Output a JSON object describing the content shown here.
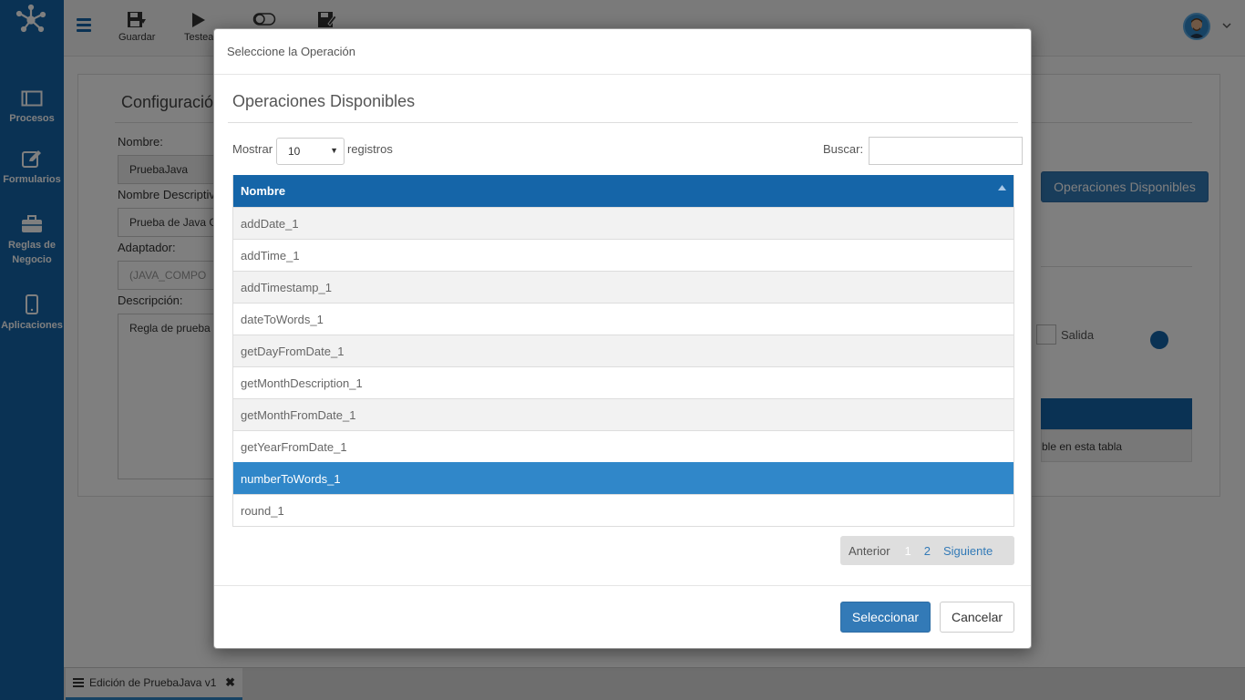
{
  "sidebar": {
    "items": [
      {
        "label": "Procesos",
        "icon": "window-icon"
      },
      {
        "label": "Formularios",
        "icon": "edit-icon"
      },
      {
        "label": "Reglas de Negocio",
        "icon": "briefcase-icon"
      },
      {
        "label": "Aplicaciones",
        "icon": "mobile-icon"
      }
    ]
  },
  "toolbar": {
    "save_label": "Guardar",
    "test_label": "Testea"
  },
  "background": {
    "panel_title": "Configuració",
    "nombre_label": "Nombre:",
    "nombre_value": "PruebaJava",
    "nombre_desc_label": "Nombre Descriptiv",
    "nombre_desc_value": "Prueba de Java C",
    "adaptador_label": "Adaptador:",
    "adaptador_value": "(JAVA_COMPO",
    "descripcion_label": "Descripción:",
    "descripcion_value": "Regla de prueba",
    "operaciones_button": "Operaciones Disponibles",
    "salida_label": "Salida",
    "table_empty": "ble en esta tabla"
  },
  "tabbar": {
    "tab_label": "Edición de PruebaJava v1"
  },
  "modal": {
    "title": "Seleccione la Operación",
    "section_title": "Operaciones Disponibles",
    "show_label": "Mostrar",
    "page_length": "10",
    "records_label": "registros",
    "search_label": "Buscar:",
    "search_value": "",
    "column_header": "Nombre",
    "rows": [
      "addDate_1",
      "addTime_1",
      "addTimestamp_1",
      "dateToWords_1",
      "getDayFromDate_1",
      "getMonthDescription_1",
      "getMonthFromDate_1",
      "getYearFromDate_1",
      "numberToWords_1",
      "round_1"
    ],
    "selected_row": "numberToWords_1",
    "pagination": {
      "previous": "Anterior",
      "current": "1",
      "page2": "2",
      "next": "Siguiente"
    },
    "select_button": "Seleccionar",
    "cancel_button": "Cancelar"
  },
  "colors": {
    "brand": "#1565a8",
    "selected_row": "#3087c9",
    "primary_button": "#337ab7"
  }
}
